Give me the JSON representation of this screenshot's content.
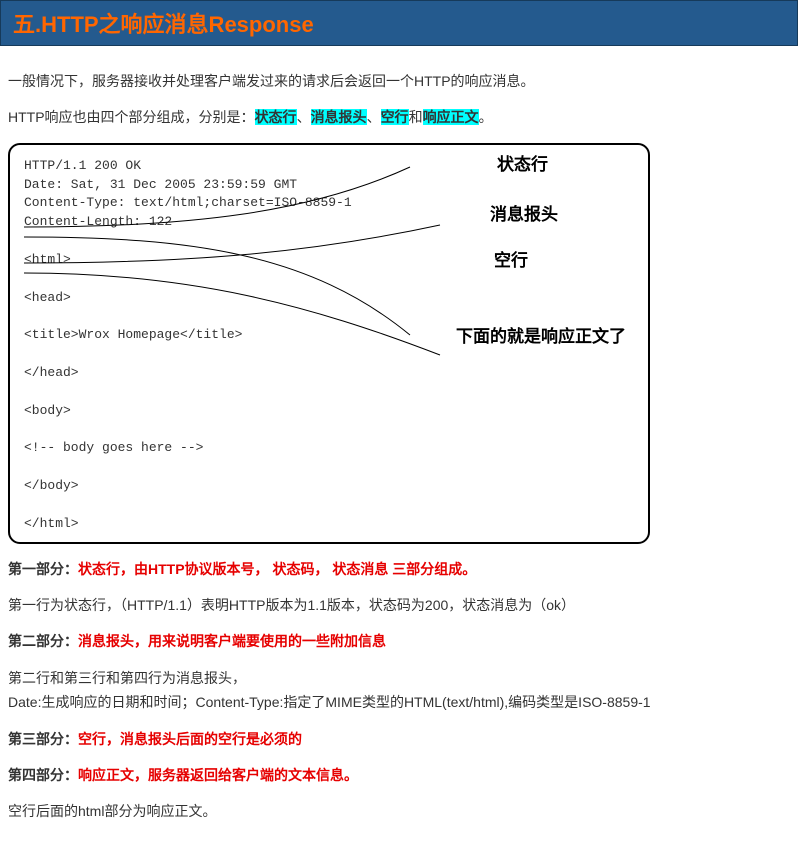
{
  "header": {
    "title": "五.HTTP之响应消息Response"
  },
  "intro": {
    "p1": "一般情况下，服务器接收并处理客户端发过来的请求后会返回一个HTTP的响应消息。",
    "p2_prefix": "HTTP响应也由四个部分组成，分别是：",
    "hl1": "状态行",
    "sep1": "、",
    "hl2": "消息报头",
    "sep2": "、",
    "hl3": "空行",
    "sep3": "和",
    "hl4": "响应正文",
    "p2_suffix": "。"
  },
  "diagram": {
    "status_line": "HTTP/1.1 200 OK",
    "date_line": "Date: Sat, 31 Dec 2005 23:59:59 GMT",
    "ctype_line": "Content-Type: text/html;charset=ISO-8859-1",
    "clen_line": "Content-Length: 122",
    "html_open": "<html>",
    "head_open": "<head>",
    "title_line": "<title>Wrox Homepage</title>",
    "head_close": "</head>",
    "body_open": "<body>",
    "comment": "<!-- body goes here -->",
    "body_close": "</body>",
    "html_close": "</html>",
    "ann_status": "状态行",
    "ann_headers": "消息报头",
    "ann_blank": "空行",
    "ann_body": "下面的就是响应正文了"
  },
  "parts": {
    "p1_label": "第一部分：",
    "p1_red": "状态行，由HTTP协议版本号， 状态码， 状态消息 三部分组成。",
    "p1_desc": "第一行为状态行，（HTTP/1.1）表明HTTP版本为1.1版本，状态码为200，状态消息为（ok）",
    "p2_label": "第二部分：",
    "p2_red": "消息报头，用来说明客户端要使用的一些附加信息",
    "p2_desc1": "第二行和第三行和第四行为消息报头，",
    "p2_desc2": "Date:生成响应的日期和时间；Content-Type:指定了MIME类型的HTML(text/html),编码类型是ISO-8859-1",
    "p3_label": "第三部分：",
    "p3_red": "空行，消息报头后面的空行是必须的",
    "p4_label": "第四部分：",
    "p4_red": "响应正文，服务器返回给客户端的文本信息。",
    "p4_desc": "空行后面的html部分为响应正文。"
  }
}
